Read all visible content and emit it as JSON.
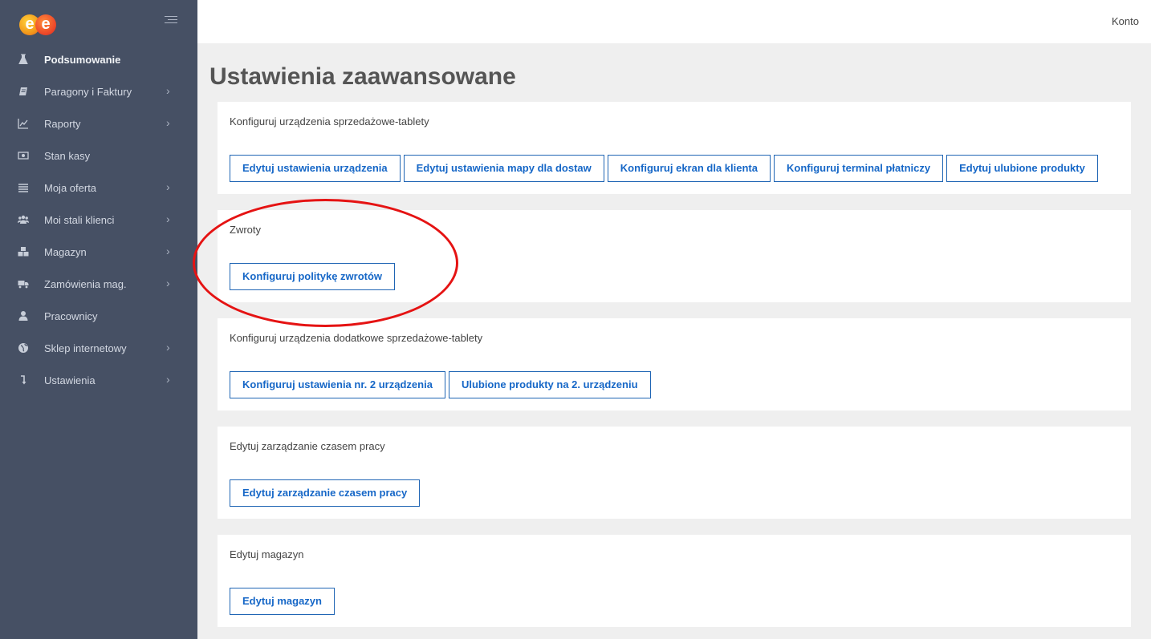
{
  "brand": {
    "logo_letters": [
      "e",
      "e"
    ]
  },
  "topbar": {
    "account_label": "Konto"
  },
  "sidebar": {
    "items": [
      {
        "label": "Podsumowanie",
        "icon": "flask-icon",
        "has_submenu": false,
        "active": true
      },
      {
        "label": "Paragony i Faktury",
        "icon": "book-icon",
        "has_submenu": true
      },
      {
        "label": "Raporty",
        "icon": "line-chart-icon",
        "has_submenu": true
      },
      {
        "label": "Stan kasy",
        "icon": "money-icon",
        "has_submenu": false
      },
      {
        "label": "Moja oferta",
        "icon": "list-icon",
        "has_submenu": true
      },
      {
        "label": "Moi stali klienci",
        "icon": "users-icon",
        "has_submenu": true
      },
      {
        "label": "Magazyn",
        "icon": "cubes-icon",
        "has_submenu": true
      },
      {
        "label": "Zamówienia mag.",
        "icon": "truck-icon",
        "has_submenu": true
      },
      {
        "label": "Pracownicy",
        "icon": "user-icon",
        "has_submenu": false
      },
      {
        "label": "Sklep internetowy",
        "icon": "globe-icon",
        "has_submenu": true
      },
      {
        "label": "Ustawienia",
        "icon": "arrow-down-icon",
        "has_submenu": true
      }
    ],
    "chevron": "›"
  },
  "page": {
    "title": "Ustawienia zaawansowane"
  },
  "sections": [
    {
      "title": "Konfiguruj urządzenia sprzedażowe-tablety",
      "buttons": [
        "Edytuj ustawienia urządzenia",
        "Edytuj ustawienia mapy dla dostaw",
        "Konfiguruj ekran dla klienta",
        "Konfiguruj terminal płatniczy",
        "Edytuj ulubione produkty"
      ]
    },
    {
      "title": "Zwroty",
      "buttons": [
        "Konfiguruj politykę zwrotów"
      ]
    },
    {
      "title": "Konfiguruj urządzenia dodatkowe sprzedażowe-tablety",
      "buttons": [
        "Konfiguruj ustawienia nr. 2 urządzenia",
        "Ulubione produkty na 2. urządzeniu"
      ]
    },
    {
      "title": "Edytuj zarządzanie czasem pracy",
      "buttons": [
        "Edytuj zarządzanie czasem pracy"
      ]
    },
    {
      "title": "Edytuj magazyn",
      "buttons": [
        "Edytuj magazyn"
      ]
    }
  ],
  "colors": {
    "sidebar_bg": "#465064",
    "button_text": "#1667c7",
    "annotation": "#e51313"
  }
}
